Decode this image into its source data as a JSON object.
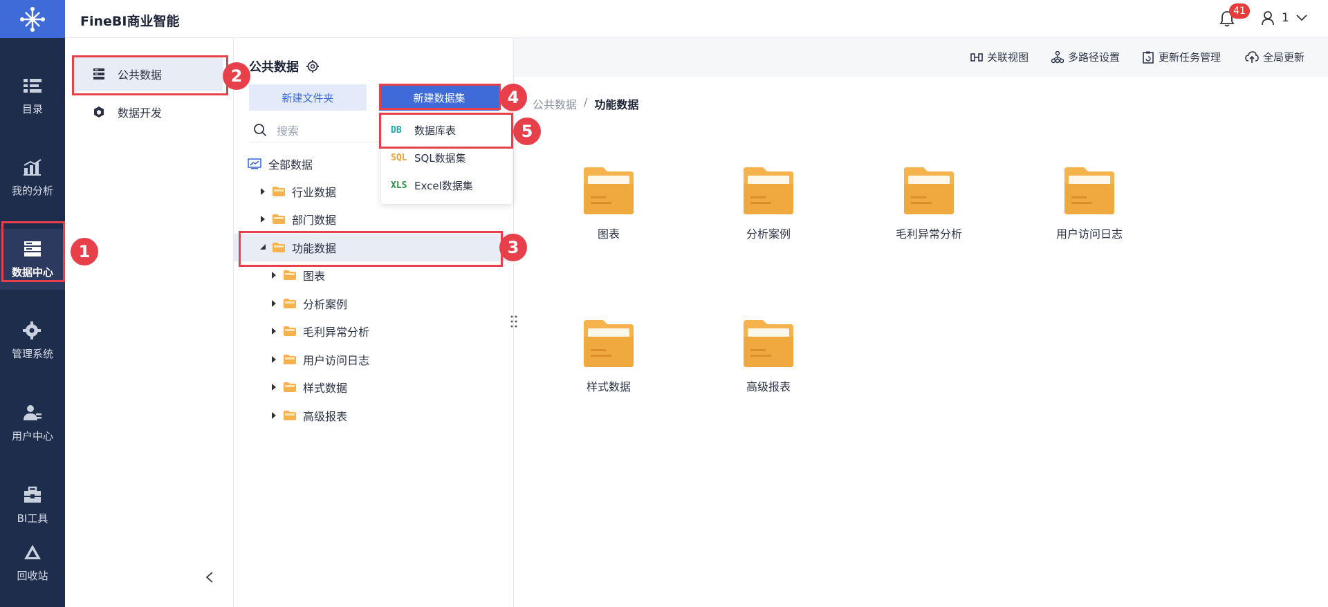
{
  "app": {
    "title": "FineBI商业智能"
  },
  "header": {
    "notification_count": "41",
    "user_name": "1"
  },
  "leftnav": {
    "items": [
      {
        "label": "目录",
        "icon": "catalog-icon"
      },
      {
        "label": "我的分析",
        "icon": "analysis-icon"
      },
      {
        "label": "数据中心",
        "icon": "data-center-icon",
        "active": true
      },
      {
        "label": "管理系统",
        "icon": "gear-icon"
      },
      {
        "label": "用户中心",
        "icon": "user-icon"
      },
      {
        "label": "BI工具",
        "icon": "toolbox-icon"
      },
      {
        "label": "回收站",
        "icon": "recycle-icon"
      }
    ]
  },
  "submenu": {
    "items": [
      {
        "label": "公共数据",
        "icon": "public-data-icon",
        "active": true
      },
      {
        "label": "数据开发",
        "icon": "data-dev-icon"
      }
    ]
  },
  "tree_panel": {
    "title": "公共数据",
    "new_folder_label": "新建文件夹",
    "new_dataset_label": "新建数据集",
    "search_placeholder": "搜索",
    "root_label": "全部数据",
    "nodes": [
      {
        "label": "行业数据",
        "level": 1,
        "expanded": false
      },
      {
        "label": "部门数据",
        "level": 1,
        "expanded": false
      },
      {
        "label": "功能数据",
        "level": 1,
        "expanded": true,
        "selected": true
      },
      {
        "label": "图表",
        "level": 2,
        "expanded": false
      },
      {
        "label": "分析案例",
        "level": 2,
        "expanded": false
      },
      {
        "label": "毛利异常分析",
        "level": 2,
        "expanded": false
      },
      {
        "label": "用户访问日志",
        "level": 2,
        "expanded": false
      },
      {
        "label": "样式数据",
        "level": 2,
        "expanded": false
      },
      {
        "label": "高级报表",
        "level": 2,
        "expanded": false
      }
    ]
  },
  "dropdown": {
    "items": [
      {
        "tag": "DB",
        "label": "数据库表",
        "color": "#27a5a5"
      },
      {
        "tag": "SQL",
        "label": "SQL数据集",
        "color": "#e8a23a"
      },
      {
        "tag": "XLS",
        "label": "Excel数据集",
        "color": "#2a8f3c"
      }
    ]
  },
  "toolbar": {
    "items": [
      {
        "label": "关联视图",
        "icon": "relation-view-icon"
      },
      {
        "label": "多路径设置",
        "icon": "multi-path-icon"
      },
      {
        "label": "更新任务管理",
        "icon": "update-task-icon"
      },
      {
        "label": "全局更新",
        "icon": "cloud-update-icon"
      }
    ]
  },
  "breadcrumb": {
    "root": "公共数据",
    "separator": "/",
    "current": "功能数据"
  },
  "folders": [
    {
      "label": "图表"
    },
    {
      "label": "分析案例"
    },
    {
      "label": "毛利异常分析"
    },
    {
      "label": "用户访问日志"
    },
    {
      "label": "样式数据"
    },
    {
      "label": "高级报表"
    }
  ],
  "annotations": [
    "1",
    "2",
    "3",
    "4",
    "5"
  ],
  "colors": {
    "brand": "#3f6bd8",
    "nav_bg": "#1f2d4d",
    "annotation": "#e8404a",
    "folder": "#f5b24d"
  }
}
